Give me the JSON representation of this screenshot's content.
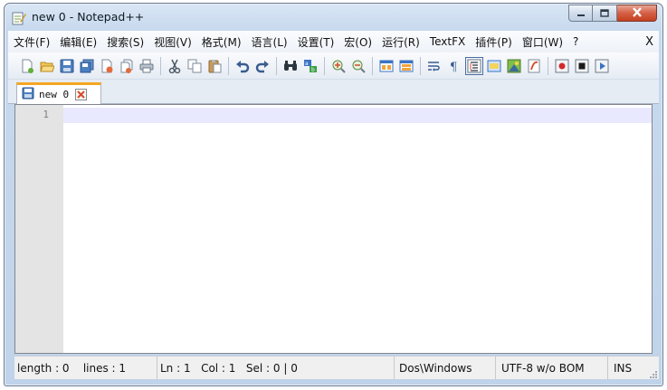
{
  "window": {
    "title": "new  0 - Notepad++",
    "controls": {
      "minimize": "minimize",
      "maximize": "maximize",
      "close": "close"
    }
  },
  "menu": {
    "items": [
      "文件(F)",
      "编辑(E)",
      "搜索(S)",
      "视图(V)",
      "格式(M)",
      "语言(L)",
      "设置(T)",
      "宏(O)",
      "运行(R)",
      "TextFX",
      "插件(P)",
      "窗口(W)",
      "?"
    ],
    "close_label": "X"
  },
  "toolbar": {
    "buttons": [
      "new-file-icon",
      "open-file-icon",
      "save-icon",
      "save-all-icon",
      "close-icon",
      "close-all-icon",
      "print-icon",
      "cut-icon",
      "copy-icon",
      "paste-icon",
      "undo-icon",
      "redo-icon",
      "find-icon",
      "replace-icon",
      "zoom-in-icon",
      "zoom-out-icon",
      "sync-vertical-icon",
      "sync-horizontal-icon",
      "word-wrap-icon",
      "show-all-chars-icon",
      "indent-guide-icon",
      "user-lang-icon",
      "doc-map-icon",
      "function-list-icon",
      "record-macro-icon",
      "stop-macro-icon",
      "play-macro-icon"
    ]
  },
  "tabs": [
    {
      "label": "new  0",
      "active": true
    }
  ],
  "editor": {
    "line_numbers": [
      "1"
    ],
    "content": ""
  },
  "status": {
    "length": "length : 0",
    "lines": "lines : 1",
    "ln": "Ln : 1",
    "col": "Col : 1",
    "sel": "Sel : 0 | 0",
    "eol": "Dos\\Windows",
    "encoding": "UTF-8 w/o BOM",
    "mode": "INS"
  },
  "colors": {
    "tab_accent": "#f5a623",
    "current_line": "#e8e8ff",
    "gutter": "#e4e4e4"
  }
}
